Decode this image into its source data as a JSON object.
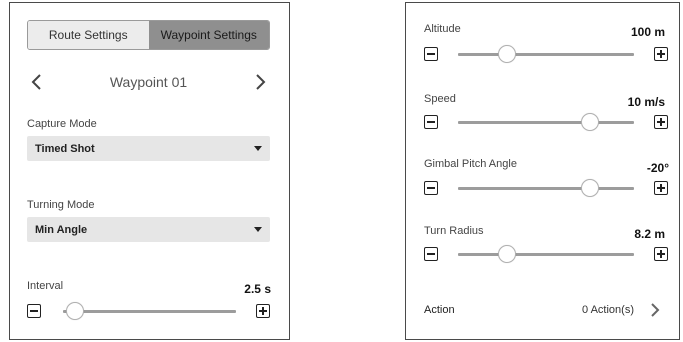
{
  "left_panel": {
    "tabs": [
      {
        "label": "Route Settings",
        "active": false
      },
      {
        "label": "Waypoint Settings",
        "active": true
      }
    ],
    "waypoint_title": "Waypoint 01",
    "capture_mode": {
      "label": "Capture Mode",
      "value": "Timed Shot"
    },
    "turning_mode": {
      "label": "Turning Mode",
      "value": "Min Angle"
    },
    "interval": {
      "label": "Interval",
      "value": "2.5 s",
      "level": 0.07
    }
  },
  "right_panel": {
    "sliders": [
      {
        "label": "Altitude",
        "value": "100 m",
        "level": 0.28
      },
      {
        "label": "Speed",
        "value": "10 m/s",
        "level": 0.75
      },
      {
        "label": "Gimbal Pitch Angle",
        "value": "-20°",
        "level": 0.75
      },
      {
        "label": "Turn Radius",
        "value": "8.2 m",
        "level": 0.28
      }
    ],
    "action": {
      "label": "Action",
      "count": "0 Action(s)"
    }
  },
  "icons": {
    "prev": "chevron-left-icon",
    "next": "chevron-right-icon",
    "dropdown": "caret-down-icon",
    "decrease": "minus-square-icon",
    "increase": "plus-square-icon",
    "action": "chevron-right-icon"
  },
  "colors": {
    "active_tab": "#8f8f8f",
    "inactive_tab": "#ececec",
    "dropdown_bg": "#e6e6e6",
    "track": "#9c9c9c"
  }
}
